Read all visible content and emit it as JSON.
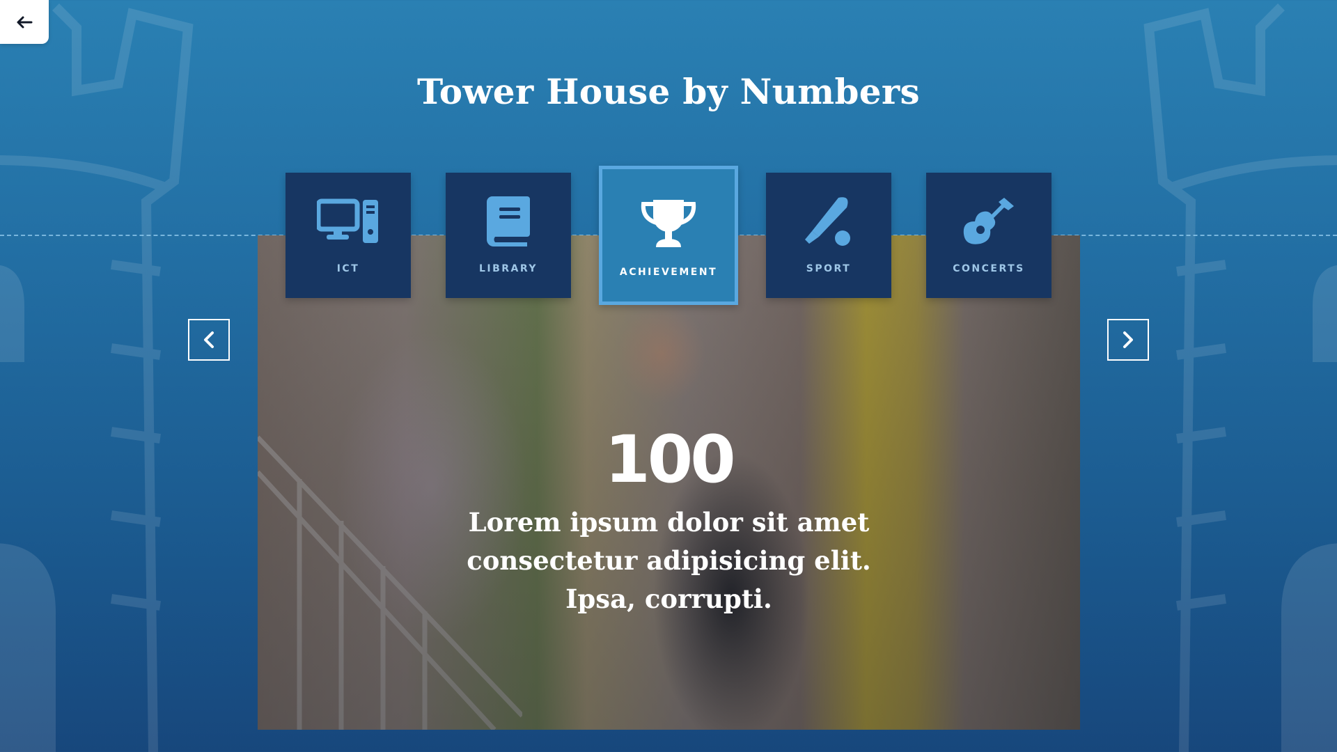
{
  "page": {
    "title": "Tower House by Numbers"
  },
  "tabs": [
    {
      "label": "ICT",
      "icon": "computer-icon",
      "active": false
    },
    {
      "label": "LIBRARY",
      "icon": "book-icon",
      "active": false
    },
    {
      "label": "ACHIEVEMENT",
      "icon": "trophy-icon",
      "active": true
    },
    {
      "label": "SPORT",
      "icon": "baseball-icon",
      "active": false
    },
    {
      "label": "CONCERTS",
      "icon": "guitar-icon",
      "active": false
    }
  ],
  "slide": {
    "stat": "100",
    "description": "Lorem ipsum dolor sit amet consectetur adipisicing elit. Ipsa, corrupti."
  },
  "colors": {
    "background": "#2275a8",
    "tab": "#173662",
    "tab_active": "#2a80b3",
    "tab_active_border": "#5aa8e0",
    "tab_label": "#9fc7e7",
    "icon": "#5aa8e0"
  }
}
